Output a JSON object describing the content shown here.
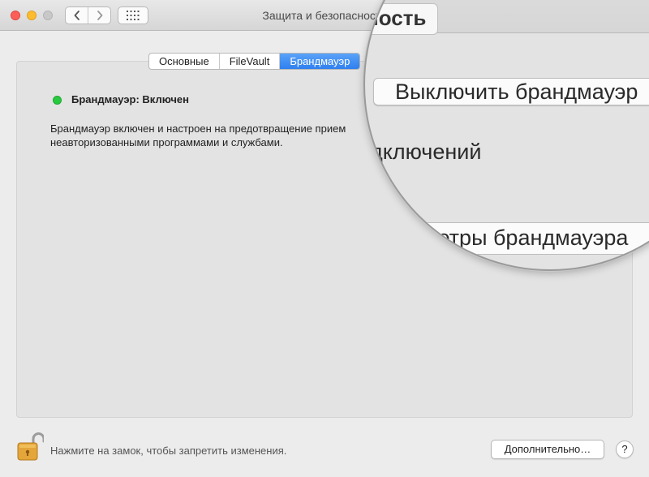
{
  "window": {
    "title": "Защита и безопасность"
  },
  "toolbar": {
    "back_icon": "chevron-left-icon",
    "forward_icon": "chevron-right-icon",
    "show_all_icon": "grid-icon"
  },
  "tabs": [
    {
      "label": "Основные",
      "active": false
    },
    {
      "label": "FileVault",
      "active": false
    },
    {
      "label": "Брандмауэр",
      "active": true
    }
  ],
  "firewall": {
    "status_color": "#27c93f",
    "status_text": "Брандмауэр: Включен",
    "description": "Брандмауэр включен и настроен на предотвращение прием неавторизованными программами и службами."
  },
  "magnifier": {
    "title_fragment": "ность",
    "turn_off_button": "Выключить брандмауэр",
    "text_fragment": "дключений",
    "options_button_fragment": "метры брандмауэра"
  },
  "footer": {
    "lock_icon": "unlocked-padlock-icon",
    "lock_text": "Нажмите на замок, чтобы запретить изменения.",
    "advanced_button": "Дополнительно…",
    "help_button": "?"
  }
}
